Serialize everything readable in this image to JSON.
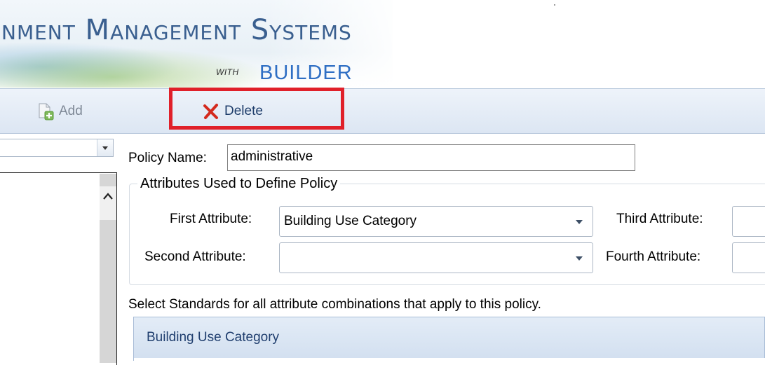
{
  "banner": {
    "title": "nment Management Systems",
    "with": "WITH",
    "builder": "BUILDER"
  },
  "toolbar": {
    "add_label": "Add",
    "delete_label": "Delete"
  },
  "form": {
    "policy_name_label": "Policy Name:",
    "policy_name_value": "administrative",
    "group_title": "Attributes Used to Define Policy",
    "first_attribute_label": "First Attribute:",
    "first_attribute_value": "Building Use Category",
    "second_attribute_label": "Second Attribute:",
    "second_attribute_value": "",
    "third_attribute_label": "Third Attribute:",
    "third_attribute_value": "",
    "fourth_attribute_label": "Fourth Attribute:",
    "fourth_attribute_value": "",
    "instruction": "Select Standards for all attribute combinations that apply to this policy."
  },
  "grid": {
    "columns": [
      "Building Use Category"
    ]
  },
  "colors": {
    "highlight": "#e0202a",
    "builder_text": "#2f6fc4",
    "title_text": "#3a5f8f"
  },
  "icons": [
    "add-document-icon",
    "delete-x-icon",
    "chevron-down-icon",
    "chevron-up-icon"
  ]
}
